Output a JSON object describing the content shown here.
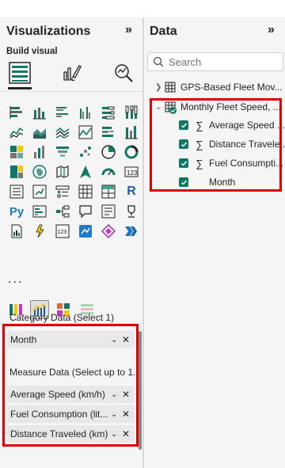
{
  "visualizations": {
    "title": "Visualizations",
    "build_label": "Build visual",
    "more_label": "...",
    "wells": {
      "category_label": "Category Data (Select 1)",
      "category_fields": [
        {
          "name": "Month"
        }
      ],
      "measure_label": "Measure Data (Select up to 1...",
      "measure_fields": [
        {
          "name": "Average Speed (km/h)"
        },
        {
          "name": "Fuel Consumption (lit..."
        },
        {
          "name": "Distance Traveled (km)"
        }
      ]
    }
  },
  "data_pane": {
    "title": "Data",
    "search_placeholder": "Search",
    "tables": [
      {
        "name": "GPS-Based Fleet Mov...",
        "expanded": false
      },
      {
        "name": "Monthly Fleet Speed, ...",
        "expanded": true,
        "fields": [
          {
            "name": "Average Speed ...",
            "checked": true,
            "icon": "sigma-icon"
          },
          {
            "name": "Distance Travele...",
            "checked": true,
            "icon": "sigma-icon"
          },
          {
            "name": "Fuel Consumpti...",
            "checked": true,
            "icon": "sigma-icon"
          },
          {
            "name": "Month",
            "checked": true,
            "icon": ""
          }
        ]
      }
    ]
  },
  "colors": {
    "highlight_box": "#e00000",
    "checkbox": "#117865",
    "pane_bg": "#f5f5f5"
  }
}
